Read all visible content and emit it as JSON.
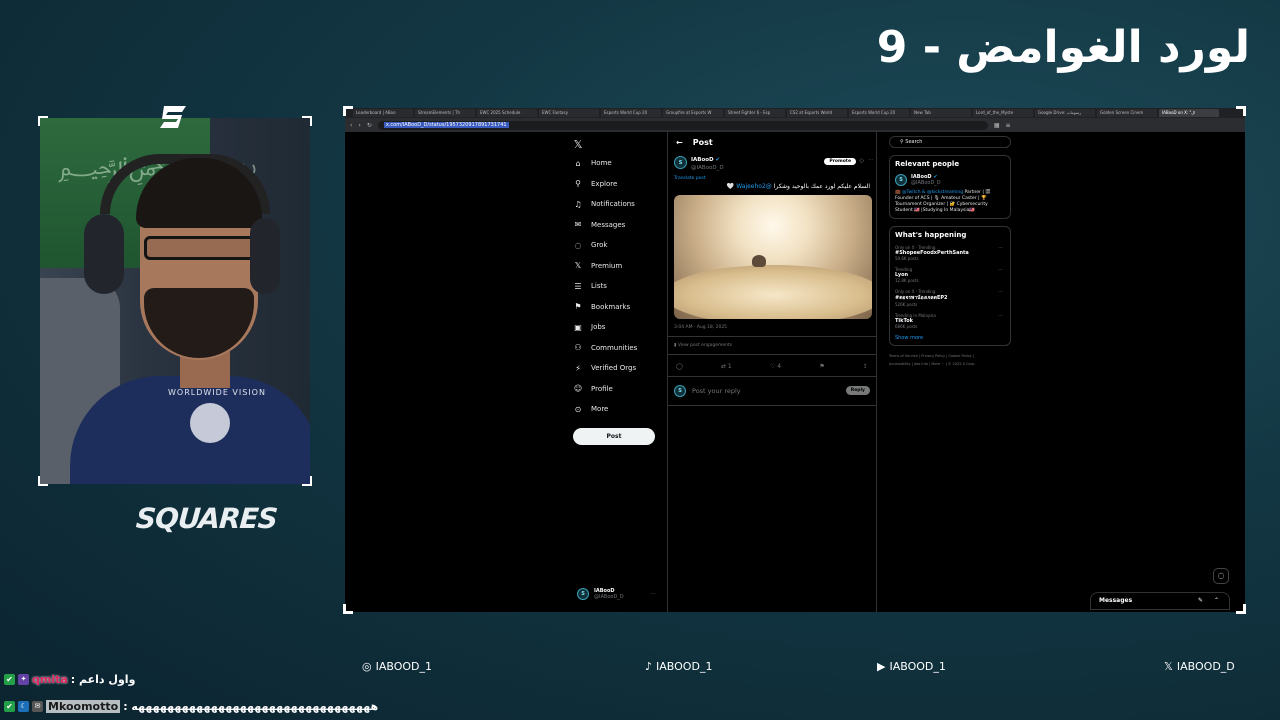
{
  "overlay": {
    "title": "لورد الغوامض - 9",
    "squares_logo": "SQUARES",
    "socials": [
      {
        "icon": "instagram-icon",
        "label": "IABOOD_1"
      },
      {
        "icon": "tiktok-icon",
        "label": "IABOOD_1"
      },
      {
        "icon": "youtube-icon",
        "label": "IABOOD_1"
      },
      {
        "icon": "x-icon",
        "label": "IABOOD_D"
      }
    ],
    "chat": [
      {
        "user": "qmita",
        "message": "واول داعم :",
        "user_color": "#e0245e"
      },
      {
        "user": "Mkoomotto",
        "message": ": هههههههههههههههههههههههههههههههههه",
        "user_color": "#1a1a1a"
      }
    ]
  },
  "browser": {
    "tabs": [
      "Leaderboard | ABoo",
      "StreamElements | Th",
      "EWC 2025 Schedule",
      "EWC Fantasy",
      "Esports World Cup 20",
      "Groupfire at Esports W",
      "Street Fighter 6 - Esp",
      "CS2 at Esports World",
      "Esports World Cup 20",
      "New Tab",
      "Lord_of_the_Myste",
      "Google Drive: رسومات",
      "Golden Screen Cinem",
      "IABooD on X: \"ال"
    ],
    "active_tab_index": 13,
    "url": "x.com/IABooD_D/status/1957320917891731741"
  },
  "x": {
    "nav": [
      {
        "label": "Home",
        "icon": "home-icon",
        "glyph": "⌂"
      },
      {
        "label": "Explore",
        "icon": "search-icon",
        "glyph": "⚲"
      },
      {
        "label": "Notifications",
        "icon": "bell-icon",
        "glyph": "♫"
      },
      {
        "label": "Messages",
        "icon": "envelope-icon",
        "glyph": "✉"
      },
      {
        "label": "Grok",
        "icon": "grok-icon",
        "glyph": "◌"
      },
      {
        "label": "Premium",
        "icon": "x-premium-icon",
        "glyph": "𝕏"
      },
      {
        "label": "Lists",
        "icon": "list-icon",
        "glyph": "☰"
      },
      {
        "label": "Bookmarks",
        "icon": "bookmark-icon",
        "glyph": "⚑"
      },
      {
        "label": "Jobs",
        "icon": "briefcase-icon",
        "glyph": "▣"
      },
      {
        "label": "Communities",
        "icon": "people-icon",
        "glyph": "⚇"
      },
      {
        "label": "Verified Orgs",
        "icon": "lightning-icon",
        "glyph": "⚡"
      },
      {
        "label": "Profile",
        "icon": "person-icon",
        "glyph": "☺"
      },
      {
        "label": "More",
        "icon": "more-circle-icon",
        "glyph": "⊙"
      }
    ],
    "post_button": "Post",
    "account": {
      "name": "IABooD",
      "handle": "@IABooD_D"
    },
    "post": {
      "header": "Post",
      "author_name": "IABooD",
      "author_handle": "@IABooD_D",
      "promote": "Promote",
      "translate": "Translate post",
      "text": "السلام عليكم لورد عمك بالوحيد وشكرا",
      "mention": "@Wajeeho2",
      "timestamp": "3:04 AM · Aug 18, 2025",
      "engagements": "View post engagements",
      "retweets": "1",
      "likes": "4",
      "reply_placeholder": "Post your reply",
      "reply_button": "Reply"
    },
    "sidebar": {
      "search_placeholder": "Search",
      "relevant_title": "Relevant people",
      "relevant": {
        "name": "IABooD",
        "handle": "@IABooD_D",
        "bio_prefix": "💼 ",
        "bio_links": "@Twitch & @kickstreaming",
        "bio_rest": "Partner | 🎬 Founder of ACS | 🎙 Amateur Caster | 🏆 Tournament Organizer | 🔐 Cybersecurity Student 🇲🇾 |Studying In Malaysia🇲🇾"
      },
      "happening_title": "What's happening",
      "trends": [
        {
          "ctx": "Only on X · Trending",
          "name": "#ShopeeFoodxPerthSanta",
          "count": "59.6K posts"
        },
        {
          "ctx": "Trending",
          "name": "Lyon",
          "count": "12.8K posts"
        },
        {
          "ctx": "Only on X · Trending",
          "name": "#ดอจรพาน้องเจลตEP2",
          "count": "526K posts"
        },
        {
          "ctx": "Trending in Malaysia",
          "name": "TikTok",
          "count": "686K posts"
        }
      ],
      "show_more": "Show more",
      "footer1": "Terms of Service  |  Privacy Policy  |  Cookie Policy  |",
      "footer2": "Accessibility  |  Ads info  |  More ···  |  © 2025 X Corp."
    },
    "messages_drawer": "Messages"
  }
}
